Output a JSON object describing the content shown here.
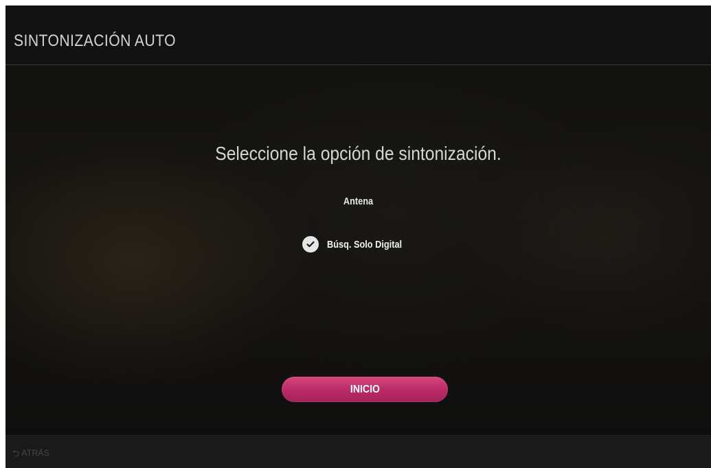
{
  "header": {
    "title": "SINTONIZACIÓN AUTO"
  },
  "main": {
    "prompt": "Seleccione la opción de sintonización.",
    "section_label": "Antena",
    "option": {
      "label": "Búsq. Solo Digital",
      "checked": true,
      "icon": "check-icon"
    },
    "start_label": "INICIO"
  },
  "footer": {
    "back_icon": "back-arrow-icon",
    "back_label": "ATRÁS"
  },
  "colors": {
    "accent": "#b92a65",
    "text": "#d6d6d6"
  }
}
